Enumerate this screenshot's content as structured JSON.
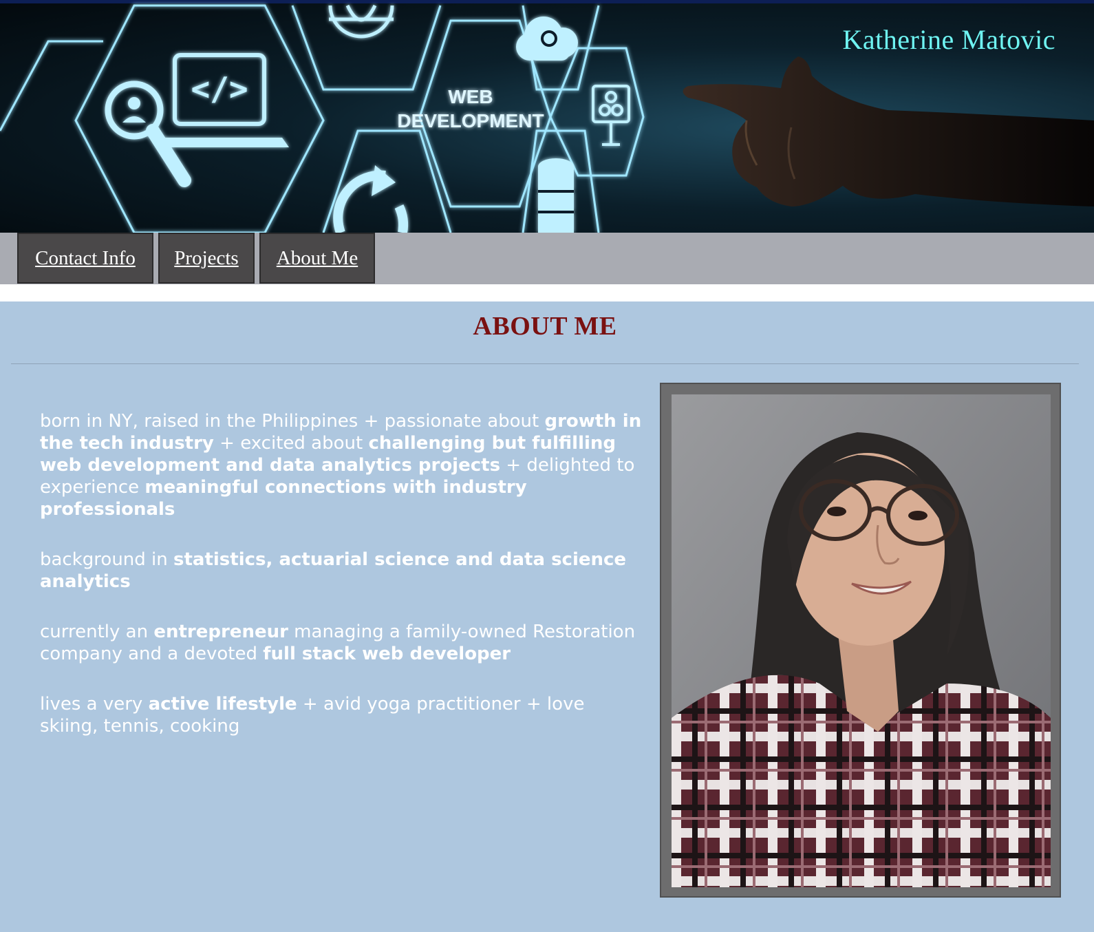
{
  "header": {
    "site_title": "Katherine Matovic",
    "banner_text_line1": "WEB",
    "banner_text_line2": "DEVELOPMENT",
    "banner_icons": [
      "user-search-icon",
      "code-laptop-icon",
      "globe-icon",
      "cloud-sync-icon",
      "hierarchy-monitor-icon",
      "refresh-code-icon",
      "database-icon"
    ]
  },
  "nav": {
    "items": [
      {
        "label": "Contact Info"
      },
      {
        "label": "Projects"
      },
      {
        "label": "About Me"
      }
    ]
  },
  "about": {
    "heading": "ABOUT ME",
    "paragraphs": [
      [
        {
          "t": "born in NY, raised in the Philippines + passionate about ",
          "b": false
        },
        {
          "t": "growth in the tech industry",
          "b": true
        },
        {
          "t": " + excited about ",
          "b": false
        },
        {
          "t": "challenging but fulfilling web development and data analytics projects",
          "b": true
        },
        {
          "t": " + delighted to experience ",
          "b": false
        },
        {
          "t": "meaningful connections with industry professionals",
          "b": true
        }
      ],
      [
        {
          "t": "background in ",
          "b": false
        },
        {
          "t": "statistics, actuarial science and data science analytics",
          "b": true
        }
      ],
      [
        {
          "t": "currently an ",
          "b": false
        },
        {
          "t": "entrepreneur",
          "b": true
        },
        {
          "t": " managing a family-owned Restoration company and a devoted ",
          "b": false
        },
        {
          "t": "full stack web developer",
          "b": true
        }
      ],
      [
        {
          "t": "lives a very ",
          "b": false
        },
        {
          "t": "active lifestyle",
          "b": true
        },
        {
          "t": " + avid yoga practitioner + love skiing, tennis, cooking",
          "b": false
        }
      ]
    ]
  },
  "colors": {
    "title": "#6ff4f2",
    "heading": "#7a1111",
    "main_bg": "#aec7df",
    "nav_bg": "#a9abb2",
    "nav_button": "#4a4849"
  }
}
